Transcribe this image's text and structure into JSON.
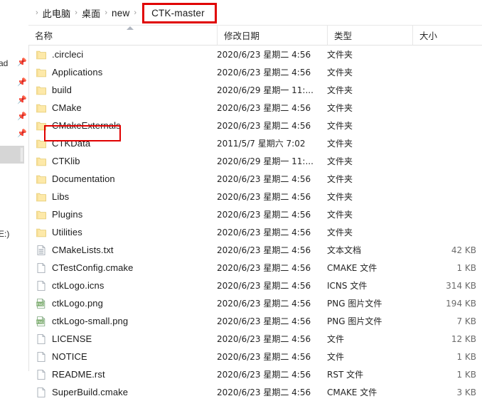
{
  "window": {
    "app": "file-explorer",
    "accent_highlight_color": "#e00000"
  },
  "breadcrumb": {
    "separator": "›",
    "items": [
      {
        "label": "此电脑"
      },
      {
        "label": "桌面"
      },
      {
        "label": "new"
      }
    ],
    "current": "CTK-master"
  },
  "sidebar": {
    "clipped_label": "ad",
    "drive_label": "E:)",
    "pin_icon": "pin-icon",
    "pin_count": 5
  },
  "columns": {
    "name": "名称",
    "date_modified": "修改日期",
    "type": "类型",
    "size": "大小",
    "sorted_by": "名称",
    "sort_direction": "ascending"
  },
  "files": [
    {
      "name": ".circleci",
      "icon": "folder-icon",
      "date": "2020/6/23 星期二 4:56",
      "type": "文件夹",
      "size": ""
    },
    {
      "name": "Applications",
      "icon": "folder-icon",
      "date": "2020/6/23 星期二 4:56",
      "type": "文件夹",
      "size": ""
    },
    {
      "name": "build",
      "icon": "folder-icon",
      "date": "2020/6/29 星期一 11:...",
      "type": "文件夹",
      "size": ""
    },
    {
      "name": "CMake",
      "icon": "folder-icon",
      "date": "2020/6/23 星期二 4:56",
      "type": "文件夹",
      "size": ""
    },
    {
      "name": "CMakeExternals",
      "icon": "folder-icon",
      "date": "2020/6/23 星期二 4:56",
      "type": "文件夹",
      "size": ""
    },
    {
      "name": "CTKData",
      "icon": "folder-icon",
      "date": "2011/5/7 星期六 7:02",
      "type": "文件夹",
      "size": "",
      "highlighted": true
    },
    {
      "name": "CTKlib",
      "icon": "folder-icon",
      "date": "2020/6/29 星期一 11:...",
      "type": "文件夹",
      "size": ""
    },
    {
      "name": "Documentation",
      "icon": "folder-icon",
      "date": "2020/6/23 星期二 4:56",
      "type": "文件夹",
      "size": ""
    },
    {
      "name": "Libs",
      "icon": "folder-icon",
      "date": "2020/6/23 星期二 4:56",
      "type": "文件夹",
      "size": ""
    },
    {
      "name": "Plugins",
      "icon": "folder-icon",
      "date": "2020/6/23 星期二 4:56",
      "type": "文件夹",
      "size": ""
    },
    {
      "name": "Utilities",
      "icon": "folder-icon",
      "date": "2020/6/23 星期二 4:56",
      "type": "文件夹",
      "size": ""
    },
    {
      "name": "CMakeLists.txt",
      "icon": "text-file-icon",
      "date": "2020/6/23 星期二 4:56",
      "type": "文本文档",
      "size": "42 KB"
    },
    {
      "name": "CTestConfig.cmake",
      "icon": "blank-file-icon",
      "date": "2020/6/23 星期二 4:56",
      "type": "CMAKE 文件",
      "size": "1 KB"
    },
    {
      "name": "ctkLogo.icns",
      "icon": "blank-file-icon",
      "date": "2020/6/23 星期二 4:56",
      "type": "ICNS 文件",
      "size": "314 KB"
    },
    {
      "name": "ctkLogo.png",
      "icon": "png-file-icon",
      "date": "2020/6/23 星期二 4:56",
      "type": "PNG 图片文件",
      "size": "194 KB"
    },
    {
      "name": "ctkLogo-small.png",
      "icon": "png-file-icon",
      "date": "2020/6/23 星期二 4:56",
      "type": "PNG 图片文件",
      "size": "7 KB"
    },
    {
      "name": "LICENSE",
      "icon": "blank-file-icon",
      "date": "2020/6/23 星期二 4:56",
      "type": "文件",
      "size": "12 KB"
    },
    {
      "name": "NOTICE",
      "icon": "blank-file-icon",
      "date": "2020/6/23 星期二 4:56",
      "type": "文件",
      "size": "1 KB"
    },
    {
      "name": "README.rst",
      "icon": "blank-file-icon",
      "date": "2020/6/23 星期二 4:56",
      "type": "RST 文件",
      "size": "1 KB"
    },
    {
      "name": "SuperBuild.cmake",
      "icon": "blank-file-icon",
      "date": "2020/6/23 星期二 4:56",
      "type": "CMAKE 文件",
      "size": "3 KB"
    }
  ]
}
